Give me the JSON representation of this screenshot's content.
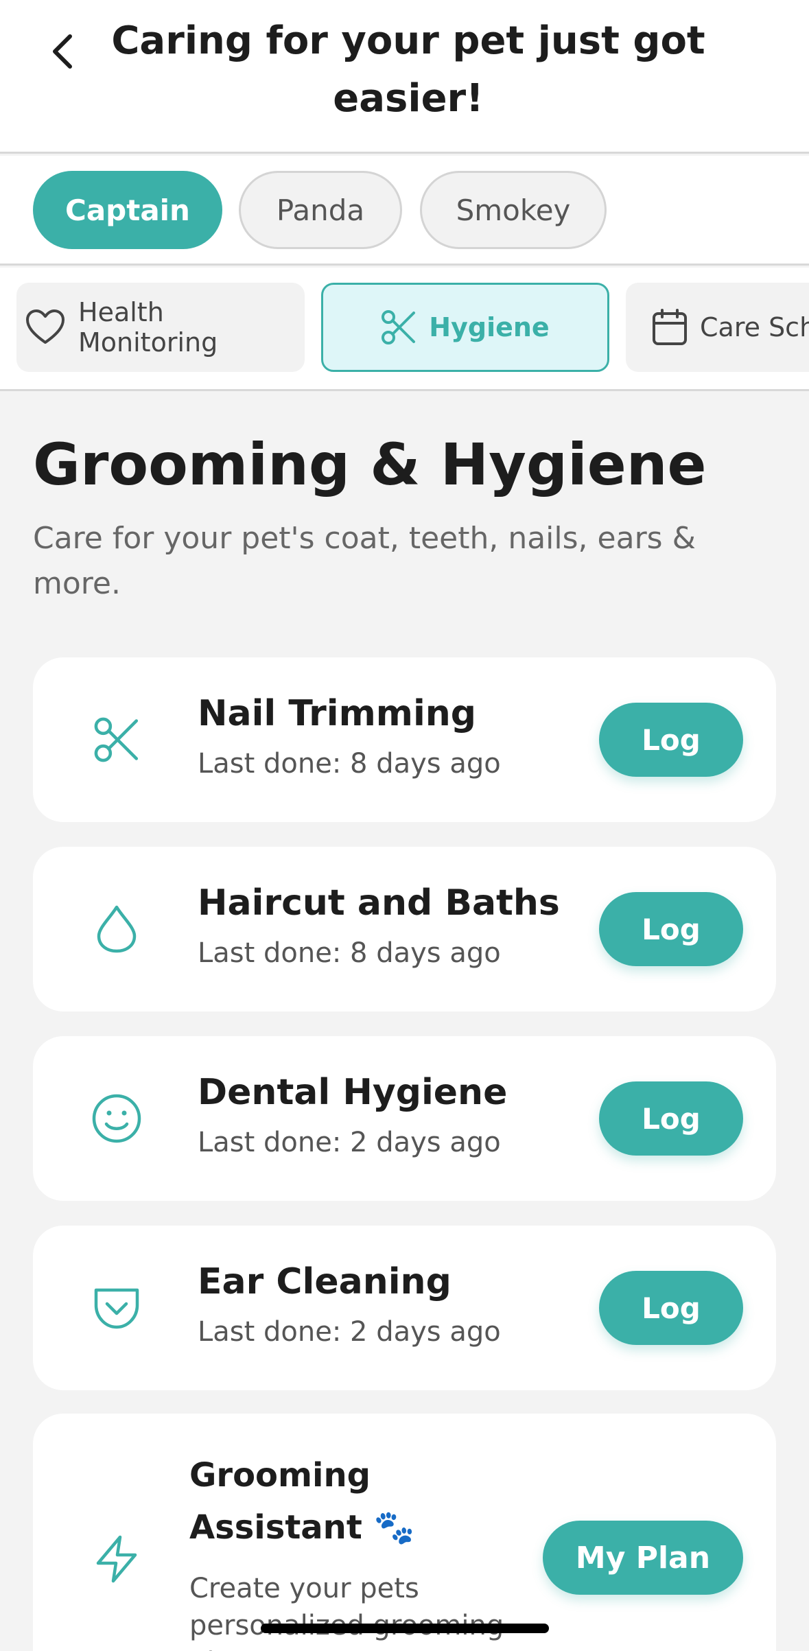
{
  "header": {
    "title": "Caring for your pet just got easier!"
  },
  "pets": [
    {
      "label": "Captain",
      "active": true
    },
    {
      "label": "Panda",
      "active": false
    },
    {
      "label": "Smokey",
      "active": false
    }
  ],
  "categories": [
    {
      "label": "Health Monitoring",
      "icon": "heart-icon",
      "active": false
    },
    {
      "label": "Hygiene",
      "icon": "scissors-icon",
      "active": true
    },
    {
      "label": "Care Sch",
      "icon": "calendar-icon",
      "active": false
    }
  ],
  "section": {
    "title": "Grooming & Hygiene",
    "subtitle": "Care for your pet's coat, teeth, nails, ears & more."
  },
  "tasks": [
    {
      "title": "Nail Trimming",
      "last_done": "Last done: 8 days ago",
      "icon": "scissors-icon",
      "button": "Log"
    },
    {
      "title": "Haircut and Baths",
      "last_done": "Last done: 8 days ago",
      "icon": "droplet-icon",
      "button": "Log"
    },
    {
      "title": "Dental Hygiene",
      "last_done": "Last done: 2 days ago",
      "icon": "smile-icon",
      "button": "Log"
    },
    {
      "title": "Ear Cleaning",
      "last_done": "Last done: 2 days ago",
      "icon": "pocket-icon",
      "button": "Log"
    }
  ],
  "assistant": {
    "title": "Grooming Assistant 🐾",
    "description": "Create your pets personalized grooming plan!",
    "icon": "lightning-icon",
    "button": "My Plan"
  },
  "colors": {
    "accent": "#3bb0a8",
    "accent_light": "#def6f8",
    "background": "#f3f3f3"
  }
}
